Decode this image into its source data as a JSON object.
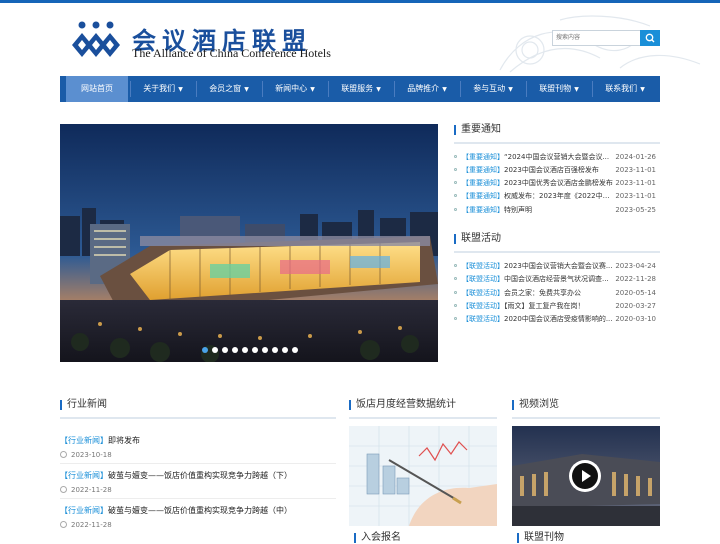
{
  "brand": {
    "cn_name": "会议酒店联盟",
    "en_name": "The Alliance of China Conference Hotels",
    "color": "#1a4f9c"
  },
  "search": {
    "placeholder": "搜索内容",
    "button_icon": "search-icon"
  },
  "nav": [
    {
      "label": "网站首页",
      "active": true,
      "caret": false
    },
    {
      "label": "关于我们",
      "caret": true
    },
    {
      "label": "会员之窗",
      "caret": true
    },
    {
      "label": "新闻中心",
      "caret": true
    },
    {
      "label": "联盟服务",
      "caret": true
    },
    {
      "label": "品牌推介",
      "caret": true
    },
    {
      "label": "参与互动",
      "caret": true
    },
    {
      "label": "联盟刊物",
      "caret": true
    },
    {
      "label": "联系我们",
      "caret": true
    }
  ],
  "notices": {
    "title": "重要通知",
    "items": [
      {
        "tag": "【重要通知】",
        "text": "“2024中国会议营销大会暨会议...",
        "date": "2024-01-26"
      },
      {
        "tag": "【重要通知】",
        "text": "2023中国会议酒店百强榜发布",
        "date": "2023-11-01"
      },
      {
        "tag": "【重要通知】",
        "text": "2023中国优秀会议酒店金鹏榜发布",
        "date": "2023-11-01"
      },
      {
        "tag": "【重要通知】",
        "text": "权威发布：2023年度《2022中国...",
        "date": "2023-11-01"
      },
      {
        "tag": "【重要通知】",
        "text": "特别声明",
        "date": "2023-05-25"
      }
    ]
  },
  "activities": {
    "title": "联盟活动",
    "items": [
      {
        "tag": "【联盟活动】",
        "text": "2023中国会议营销大会暨会议赛...",
        "date": "2023-04-24"
      },
      {
        "tag": "【联盟活动】",
        "text": "中国会议酒店经营景气状况调查...",
        "date": "2022-11-28"
      },
      {
        "tag": "【联盟活动】",
        "text": "会员之家：免费共享办公",
        "date": "2020-05-14"
      },
      {
        "tag": "【联盟活动】",
        "text": "【雨文】复工复产我在岗！",
        "date": "2020-03-27"
      },
      {
        "tag": "【联盟活动】",
        "text": "2020中国会议酒店受疫情影响的...",
        "date": "2020-03-10"
      }
    ]
  },
  "industry_news": {
    "title": "行业新闻",
    "items": [
      {
        "tag": "【行业新闻】",
        "text": "即将发布",
        "date": "2023-10-18"
      },
      {
        "tag": "【行业新闻】",
        "text": "破茧与嬗变——饭店价值重构实现竞争力跨越（下）",
        "date": "2022-11-28"
      },
      {
        "tag": "【行业新闻】",
        "text": "破茧与嬗变——饭店价值重构实现竞争力跨越（中）",
        "date": "2022-11-28"
      }
    ]
  },
  "stats": {
    "title": "饭店月度经营数据统计",
    "sub_title": "入会报名"
  },
  "video": {
    "title": "视频浏览",
    "sub_title": "联盟刊物"
  },
  "banner": {
    "dot_count": 10,
    "active_dot": 0
  }
}
